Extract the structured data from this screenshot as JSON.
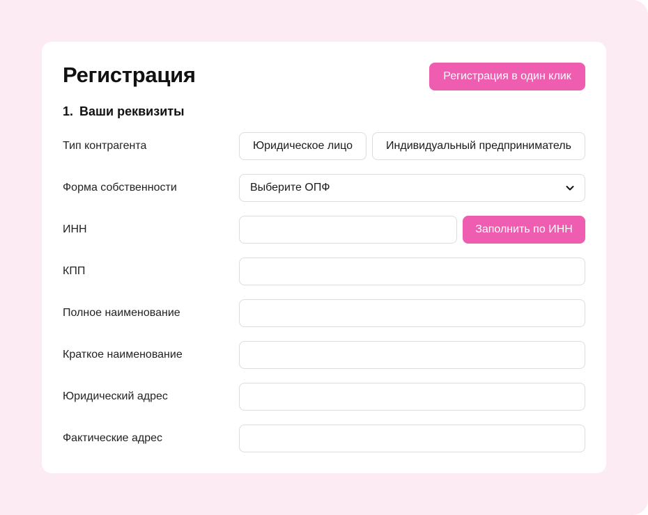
{
  "header": {
    "title": "Регистрация",
    "one_click_label": "Регистрация в один клик"
  },
  "section": {
    "number": "1.",
    "title": "Ваши реквизиты"
  },
  "form": {
    "counterparty_type": {
      "label": "Тип контрагента",
      "options": [
        "Юридическое лицо",
        "Индивидуальный предприниматель"
      ]
    },
    "ownership_form": {
      "label": "Форма собственности",
      "selected": "Выберите ОПФ"
    },
    "inn": {
      "label": "ИНН",
      "value": "",
      "fill_button": "Заполнить по ИНН"
    },
    "kpp": {
      "label": "КПП",
      "value": ""
    },
    "full_name": {
      "label": "Полное наименование",
      "value": ""
    },
    "short_name": {
      "label": "Краткое наименование",
      "value": ""
    },
    "legal_address": {
      "label": "Юридический адрес",
      "value": ""
    },
    "actual_address": {
      "label": "Фактические адрес",
      "value": ""
    }
  },
  "colors": {
    "accent": "#ee5daf",
    "page_background": "#fdebf4",
    "card_background": "#ffffff",
    "field_border": "#dcdcdc"
  },
  "icons": {
    "select_chevron": "chevron-down-icon"
  }
}
